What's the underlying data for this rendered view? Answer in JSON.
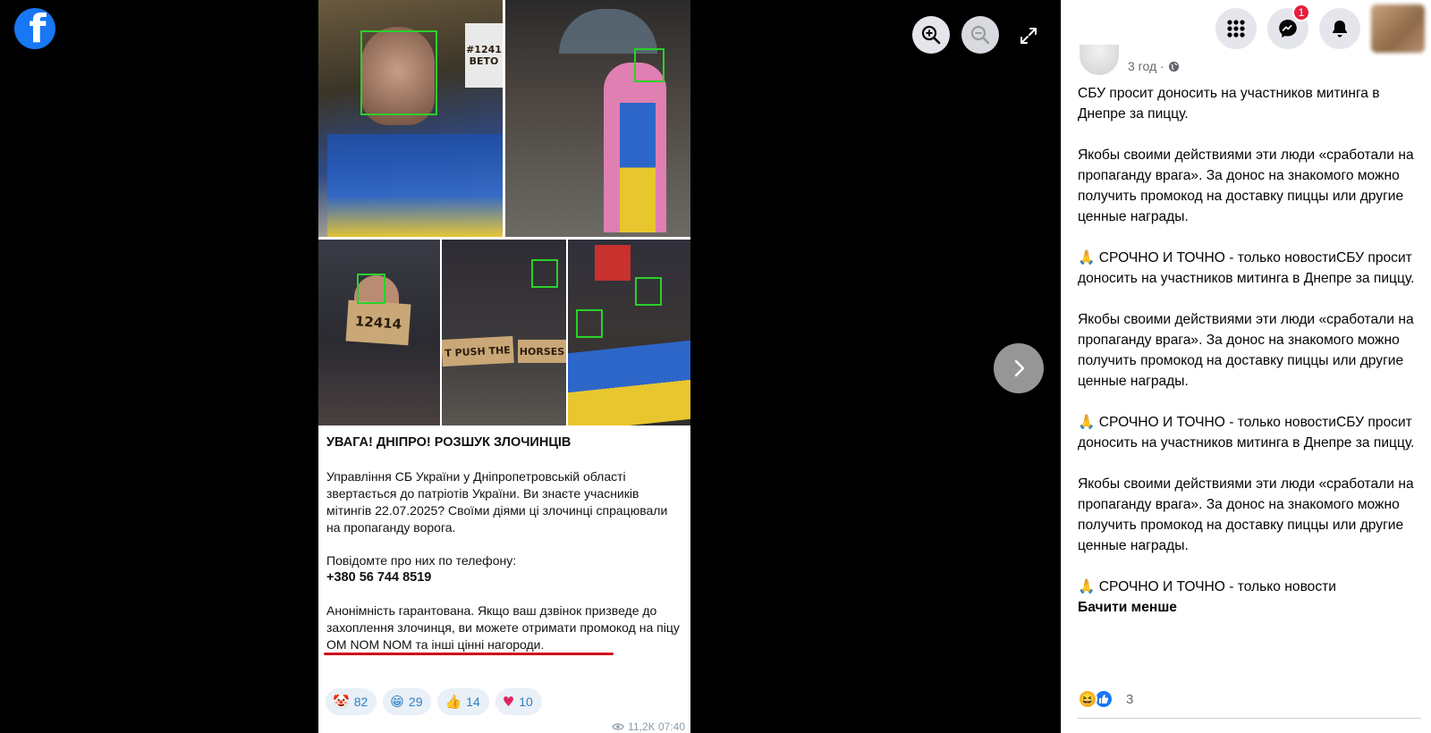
{
  "viewer": {
    "logo_glyph": "f",
    "icons": {
      "zoom_in": "zoom-in-icon",
      "zoom_out": "zoom-out-icon",
      "fullscreen": "fullscreen-icon",
      "next": "chevron-right-icon"
    },
    "post_image": {
      "signs": {
        "sign1": "#1241",
        "sign1b": "ВЕТО",
        "sign2": "12414",
        "sign3": "T PUSH THE",
        "sign4": "HORSES"
      },
      "title": "УВАГА! ДНІПРО! РОЗШУК ЗЛОЧИНЦІВ",
      "paragraph1": "Управління СБ України у Дніпропетровській області звертається до патріотів України. Ви знаєте учасників мітингів 22.07.2025? Своїми діями ці злочинці спрацювали на пропаганду ворога.",
      "paragraph2": "Повідомте про них по телефону:",
      "phone": "+380 56 744 8519",
      "paragraph3": "Анонімність гарантована. Якщо ваш дзвінок призведе до захоплення злочинця, ви можете отримати промокод на піцу OM NOM NOM та інші цінні нагороди.",
      "reactions": [
        {
          "emoji": "🤡",
          "count": "82"
        },
        {
          "emoji": "😁",
          "count": "29"
        },
        {
          "emoji": "👍",
          "count": "14"
        },
        {
          "emoji": "♥",
          "count": "10"
        }
      ],
      "views_time": "11,2K 07:40"
    }
  },
  "topbar": {
    "messenger_badge": "1",
    "icons": [
      "menu-grid-icon",
      "messenger-icon",
      "bell-icon"
    ]
  },
  "post": {
    "time": "3 год ·",
    "text": "СБУ просит доносить на участников митинга в Днепре за пиццу.\n\nЯкобы своими действиями эти люди «сработали на пропаганду врага». За донос на знакомого можно получить промокод на доставку пиццы или другие ценные награды.\n\n🙏 СРОЧНО И ТОЧНО - только новостиСБУ просит доносить на участников митинга в Днепре за пиццу.\n\nЯкобы своими действиями эти люди «сработали на пропаганду врага». За донос на знакомого можно получить промокод на доставку пиццы или другие ценные награды.\n\n🙏 СРОЧНО И ТОЧНО - только новостиСБУ просит доносить на участников митинга в Днепре за пиццу.\n\nЯкобы своими действиями эти люди «сработали на пропаганду врага». За донос на знакомого можно получить промокод на доставку пиццы или другие ценные награды.\n\n🙏 СРОЧНО И ТОЧНО - только новости",
    "see_less": "Бачити менше",
    "reaction_count": "3",
    "colors": {
      "like": "#1877f2",
      "haha": "#f7b125",
      "accent": "#1877f2"
    }
  }
}
